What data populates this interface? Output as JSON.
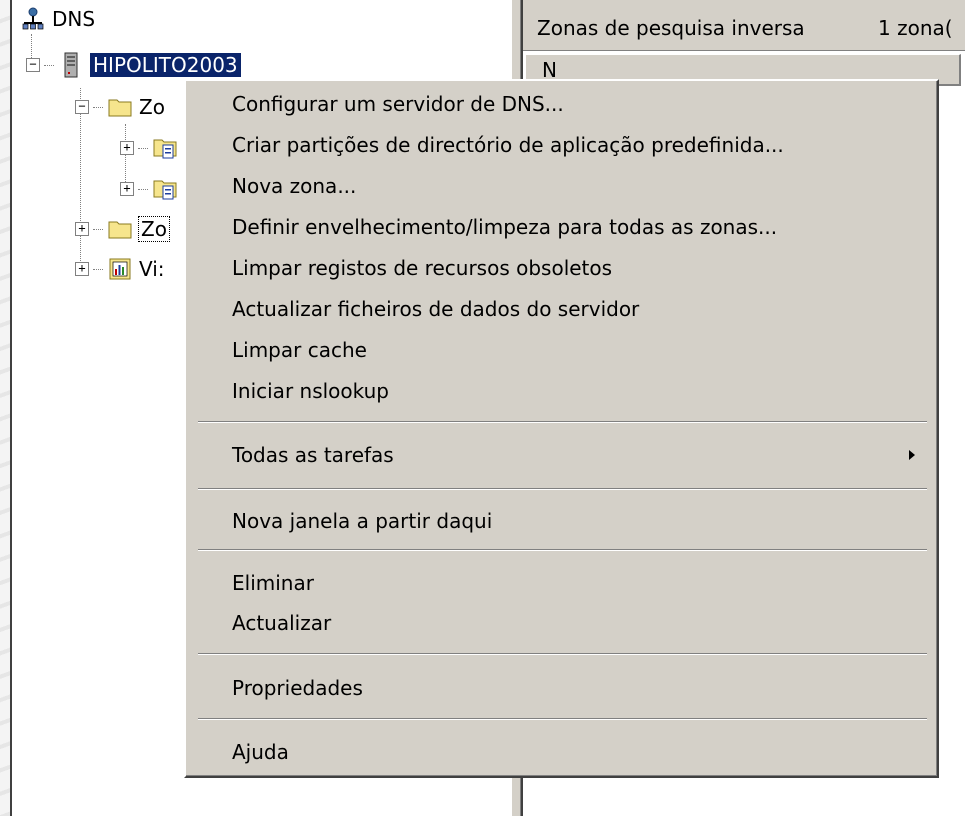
{
  "tree": {
    "root_label": "DNS",
    "server_label": "HIPOLITO2003",
    "zone1_label": "Zo",
    "zone2_label": "Zo",
    "views_label": "Vi:"
  },
  "right_pane": {
    "title": "Zonas de pesquisa inversa",
    "count": "1 zona(",
    "column_header": "N"
  },
  "context_menu": {
    "items": [
      {
        "label": "Configurar um servidor de DNS..."
      },
      {
        "label": "Criar partições de directório de aplicação predefinida..."
      },
      {
        "label": "Nova zona..."
      },
      {
        "label": "Definir envelhecimento/limpeza para todas as zonas..."
      },
      {
        "label": "Limpar registos de recursos obsoletos"
      },
      {
        "label": "Actualizar ficheiros de dados do servidor"
      },
      {
        "label": "Limpar cache"
      },
      {
        "label": "Iniciar nslookup"
      },
      {
        "label": "Todas as tarefas",
        "submenu": true
      },
      {
        "label": "Nova janela a partir daqui"
      },
      {
        "label": "Eliminar"
      },
      {
        "label": "Actualizar"
      },
      {
        "label": "Propriedades"
      },
      {
        "label": "Ajuda"
      }
    ]
  }
}
